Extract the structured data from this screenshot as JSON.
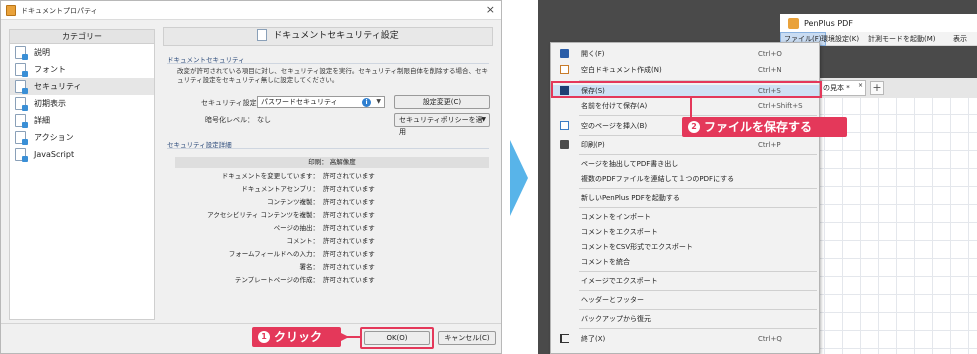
{
  "dialog": {
    "title": "ドキュメントプロパティ",
    "close_glyph": "×",
    "categories_header": "カテゴリー",
    "categories": [
      {
        "label": "説明",
        "icon": "document-icon"
      },
      {
        "label": "フォント",
        "icon": "font-icon"
      },
      {
        "label": "セキュリティ",
        "icon": "security-icon",
        "selected": true
      },
      {
        "label": "初期表示",
        "icon": "initial-view-icon"
      },
      {
        "label": "詳細",
        "icon": "advanced-icon"
      },
      {
        "label": "アクション",
        "icon": "action-icon"
      },
      {
        "label": "JavaScript",
        "icon": "javascript-icon"
      }
    ],
    "panel_title": "ドキュメントセキュリティ設定",
    "security_section": "ドキュメントセキュリティ",
    "description": "改変が許可されている項目に対し、セキュリティ設定を実行。セキュリティ制限自体を削除する場合、セキュリティ設定をセキュリティ無しに設定してください。",
    "security_setting_label": "セキュリティ設定：",
    "security_setting_value": "パスワードセキュリティ",
    "change_settings_button": "設定変更(C)",
    "encryption_label": "暗号化レベル：",
    "encryption_value": "なし",
    "apply_policy_button": "セキュリティポリシーを適用",
    "details_section": "セキュリティ設定詳細",
    "details_header": "印刷： 高解像度",
    "details": [
      {
        "key": "ドキュメントを変更しています：",
        "value": "許可されています"
      },
      {
        "key": "ドキュメントアセンブリ：",
        "value": "許可されています"
      },
      {
        "key": "コンテンツ複製：",
        "value": "許可されています"
      },
      {
        "key": "アクセシビリティ コンテンツを複製：",
        "value": "許可されています"
      },
      {
        "key": "ページの抽出：",
        "value": "許可されています"
      },
      {
        "key": "コメント：",
        "value": "許可されています"
      },
      {
        "key": "フォームフィールドへの入力：",
        "value": "許可されています"
      },
      {
        "key": "署名：",
        "value": "許可されています"
      },
      {
        "key": "テンプレートページの作成：",
        "value": "許可されています"
      }
    ],
    "ok_button": "OK(O)",
    "cancel_button": "キャンセル(C)"
  },
  "callouts": {
    "step1_number": "1",
    "step1_text": "クリック",
    "step2_number": "2",
    "step2_text": "ファイルを保存する",
    "accent_color": "#e4385a",
    "arrow_color": "#58b4e9"
  },
  "app": {
    "title": "PenPlus PDF",
    "menubar": [
      "ファイル(F)",
      "環境設定(K)",
      "計測モードを起動(M)",
      "表示"
    ],
    "doc_tab": "の見本 *",
    "doc_tab_close": "×",
    "new_tab": "+"
  },
  "file_menu": [
    {
      "label": "開く(F)",
      "shortcut": "Ctrl+O",
      "icon": "folder-icon"
    },
    {
      "label": "空白ドキュメント作成(N)",
      "shortcut": "Ctrl+N",
      "icon": "new-document-icon"
    },
    {
      "label": "保存(S)",
      "shortcut": "Ctrl+S",
      "icon": "save-icon",
      "highlight": true
    },
    {
      "label": "名前を付けて保存(A)",
      "shortcut": "Ctrl+Shift+S",
      "icon": ""
    },
    {
      "label": "空のページを挿入(B)",
      "shortcut": "",
      "icon": "insert-page-icon"
    },
    {
      "label": "印刷(P)",
      "shortcut": "Ctrl+P",
      "icon": "print-icon"
    },
    {
      "label": "ページを抽出してPDF書き出し",
      "shortcut": "",
      "icon": ""
    },
    {
      "label": "複数のPDFファイルを連結して１つのPDFにする",
      "shortcut": "",
      "icon": ""
    },
    {
      "label": "新しいPenPlus PDFを起動する",
      "shortcut": "",
      "icon": ""
    },
    {
      "label": "コメントをインポート",
      "shortcut": "",
      "icon": ""
    },
    {
      "label": "コメントをエクスポート",
      "shortcut": "",
      "icon": ""
    },
    {
      "label": "コメントをCSV形式でエクスポート",
      "shortcut": "",
      "icon": ""
    },
    {
      "label": "コメントを統合",
      "shortcut": "",
      "icon": ""
    },
    {
      "label": "イメージでエクスポート",
      "shortcut": "",
      "icon": ""
    },
    {
      "label": "ヘッダーとフッター",
      "shortcut": "",
      "icon": ""
    },
    {
      "label": "バックアップから復元",
      "shortcut": "",
      "icon": ""
    },
    {
      "label": "終了(X)",
      "shortcut": "Ctrl+Q",
      "icon": "exit-icon"
    }
  ]
}
